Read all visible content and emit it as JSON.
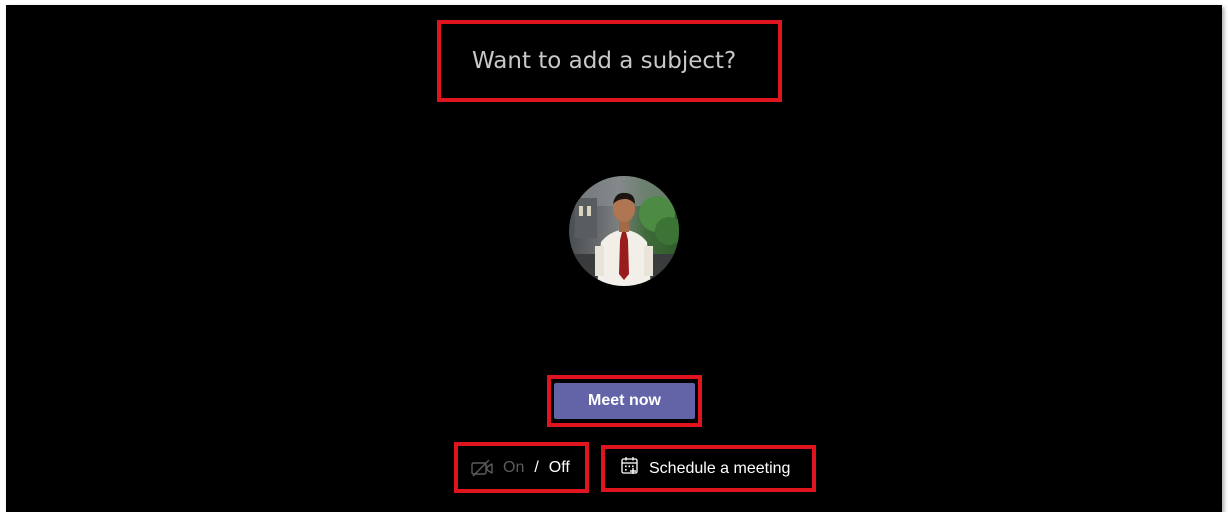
{
  "subject": {
    "placeholder": "Want to add a subject?"
  },
  "avatar": {
    "icon": "user-photo"
  },
  "meet_now": {
    "label": "Meet now",
    "color": "#6264a7"
  },
  "video_toggle": {
    "icon": "video-off-icon",
    "on_label": "On",
    "separator": "/",
    "off_label": "Off",
    "selected": "Off"
  },
  "schedule": {
    "icon": "calendar-add-icon",
    "label": "Schedule a meeting"
  },
  "colors": {
    "background": "#000000",
    "highlight": "#e0141e",
    "accent": "#6264a7"
  }
}
